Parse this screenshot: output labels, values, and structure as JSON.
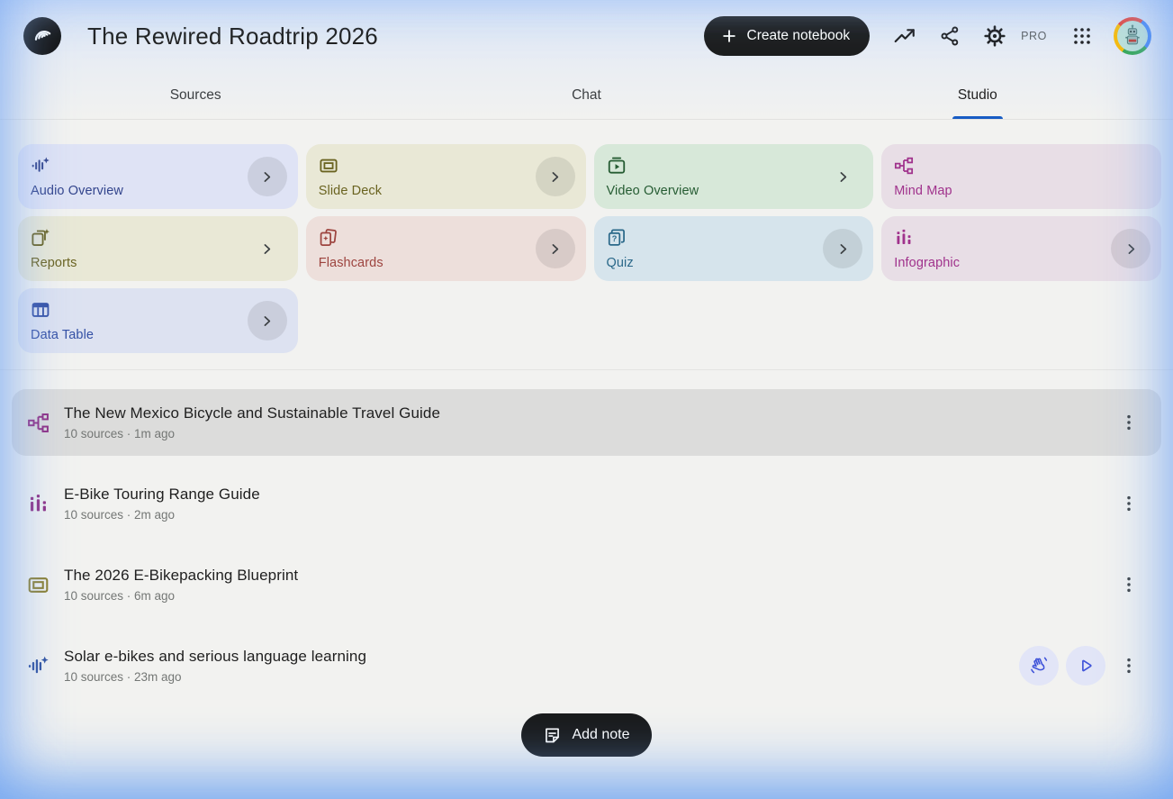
{
  "header": {
    "title": "The Rewired Roadtrip 2026",
    "create_button_label": "Create notebook",
    "pro_badge": "PRO",
    "icons": [
      "notebooklm-logo",
      "trending-up",
      "share",
      "settings-gear",
      "apps-grid",
      "account-avatar"
    ]
  },
  "tabs": {
    "items": [
      {
        "label": "Sources",
        "active": false
      },
      {
        "label": "Chat",
        "active": false
      },
      {
        "label": "Studio",
        "active": true
      }
    ],
    "active_underline_color": "#175cc4"
  },
  "studio_cards": [
    {
      "label": "Audio Overview",
      "icon": "audio-waveform-sparkle-icon",
      "bg": "#dfe3f5",
      "fg": "#32448c",
      "chevron": "circle"
    },
    {
      "label": "Slide Deck",
      "icon": "slide-deck-icon",
      "bg": "#e9e8d6",
      "fg": "#6a6320",
      "chevron": "circle"
    },
    {
      "label": "Video Overview",
      "icon": "video-overview-icon",
      "bg": "#d7e8d9",
      "fg": "#265c33",
      "chevron": "plain"
    },
    {
      "label": "Mind Map",
      "icon": "mind-map-icon",
      "bg": "#e8dee6",
      "fg": "#a0328c",
      "chevron": "none"
    },
    {
      "label": "Reports",
      "icon": "reports-icon",
      "bg": "#e9e8d6",
      "fg": "#6a6320",
      "chevron": "plain"
    },
    {
      "label": "Flashcards",
      "icon": "flashcards-icon",
      "bg": "#eddfdb",
      "fg": "#9d443f",
      "chevron": "circle"
    },
    {
      "label": "Quiz",
      "icon": "quiz-icon",
      "bg": "#d6e4ec",
      "fg": "#2a6889",
      "chevron": "circle"
    },
    {
      "label": "Infographic",
      "icon": "infographic-icon",
      "bg": "#e8dee6",
      "fg": "#a0328c",
      "chevron": "circle"
    },
    {
      "label": "Data Table",
      "icon": "data-table-icon",
      "bg": "#dde2f1",
      "fg": "#3450a5",
      "chevron": "circle"
    }
  ],
  "artifacts": {
    "items": [
      {
        "icon": "mind-map-icon",
        "fg": "#8f2d83",
        "title": "The New Mexico Bicycle and Sustainable Travel Guide",
        "meta": "10 sources · 1m ago",
        "selected": true,
        "actions": []
      },
      {
        "icon": "infographic-icon",
        "fg": "#8f2d83",
        "title": "E-Bike Touring Range Guide",
        "meta": "10 sources · 2m ago",
        "selected": false,
        "actions": []
      },
      {
        "icon": "slide-deck-icon",
        "fg": "#8a7d2a",
        "title": "The 2026 E-Bikepacking Blueprint",
        "meta": "10 sources · 6m ago",
        "selected": false,
        "actions": []
      },
      {
        "icon": "audio-waveform-sparkle-icon",
        "fg": "#2d4f9e",
        "title": "Solar e-bikes and serious language learning",
        "meta": "10 sources · 23m ago",
        "selected": false,
        "actions": [
          "interactive-mode",
          "play"
        ]
      }
    ]
  },
  "add_note_label": "Add note",
  "colors": {
    "page_bg": "#f2f2f0",
    "selected_row_bg": "#dcdcdb",
    "edge_glow": "#79a7ef",
    "button_bg": "#1c1d1e"
  }
}
